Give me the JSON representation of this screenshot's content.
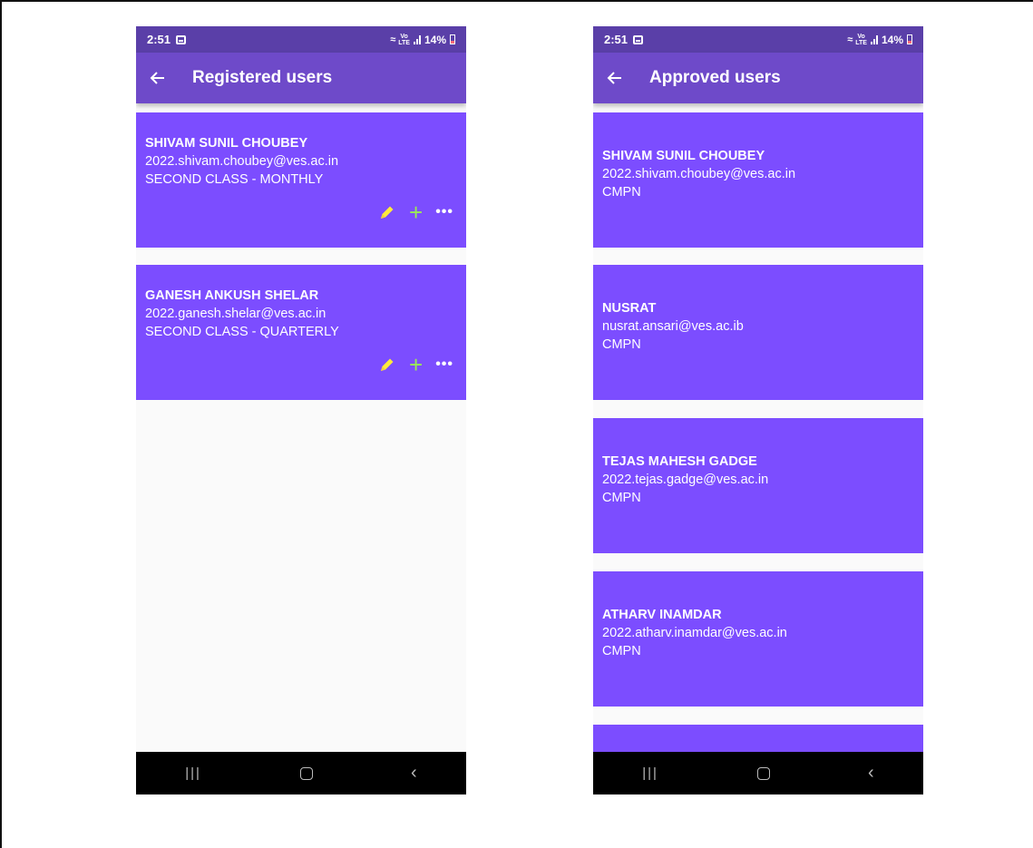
{
  "status": {
    "time": "2:51",
    "battery": "14%",
    "network": "LTE"
  },
  "left_screen": {
    "title": "Registered users",
    "users": [
      {
        "name": "SHIVAM SUNIL CHOUBEY",
        "email": "2022.shivam.choubey@ves.ac.in",
        "detail": "SECOND CLASS - MONTHLY"
      },
      {
        "name": "GANESH ANKUSH SHELAR",
        "email": "2022.ganesh.shelar@ves.ac.in",
        "detail": "SECOND CLASS - QUARTERLY"
      }
    ]
  },
  "right_screen": {
    "title": "Approved users",
    "users": [
      {
        "name": "SHIVAM SUNIL CHOUBEY",
        "email": "2022.shivam.choubey@ves.ac.in",
        "detail": "CMPN"
      },
      {
        "name": "NUSRAT",
        "email": "nusrat.ansari@ves.ac.ib",
        "detail": "CMPN"
      },
      {
        "name": "TEJAS MAHESH GADGE",
        "email": "2022.tejas.gadge@ves.ac.in",
        "detail": "CMPN"
      },
      {
        "name": "ATHARV INAMDAR",
        "email": "2022.atharv.inamdar@ves.ac.in",
        "detail": "CMPN"
      }
    ]
  },
  "colors": {
    "statusbar": "#5a3fa8",
    "appbar": "#6e4ac9",
    "card": "#7c4dff",
    "edit_icon": "#ffeb3b",
    "add_icon": "#9aea55"
  },
  "icons": [
    "back-arrow-icon",
    "pencil-icon",
    "plus-icon",
    "more-icon",
    "nav-recents-icon",
    "nav-home-icon",
    "nav-back-icon"
  ]
}
